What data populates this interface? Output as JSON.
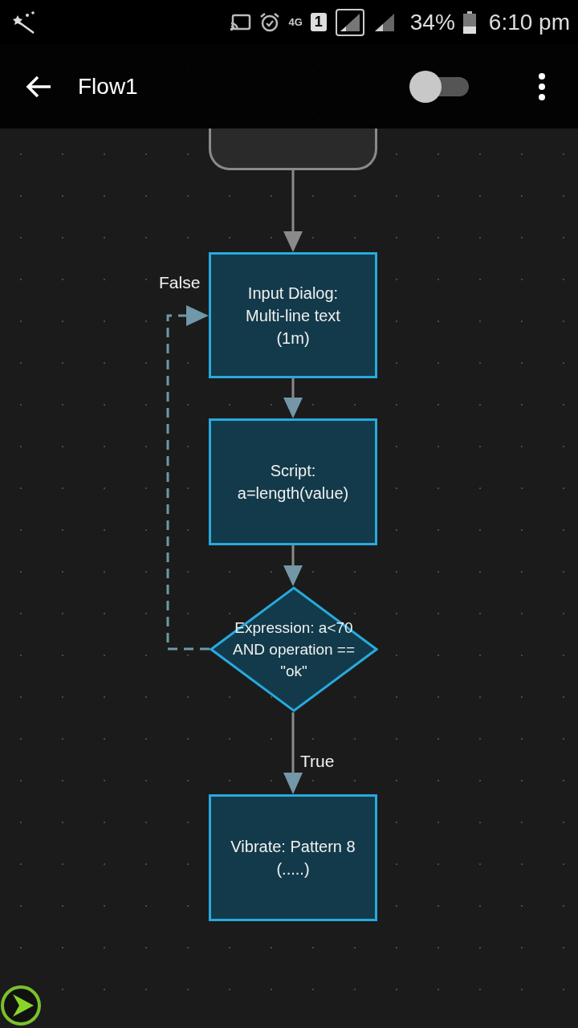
{
  "status_bar": {
    "network": "4G",
    "sim": "1",
    "battery": "34%",
    "time": "6:10 pm"
  },
  "toolbar": {
    "title": "Flow1",
    "toggle_on": false
  },
  "flow": {
    "nodes": [
      {
        "kind": "start"
      },
      {
        "kind": "action",
        "label": "Input Dialog: Multi-line text (1m)"
      },
      {
        "kind": "action",
        "label": "Script: a=length(value)"
      },
      {
        "kind": "decision",
        "label": "Expression: a<70 AND operation == \"ok\""
      },
      {
        "kind": "action",
        "label": "Vibrate: Pattern 8 (.....)"
      }
    ],
    "edges": [
      {
        "kind": "solid"
      },
      {
        "kind": "solid"
      },
      {
        "kind": "solid"
      },
      {
        "kind": "solid",
        "label": "True"
      },
      {
        "kind": "dashed",
        "label": "False"
      }
    ]
  }
}
